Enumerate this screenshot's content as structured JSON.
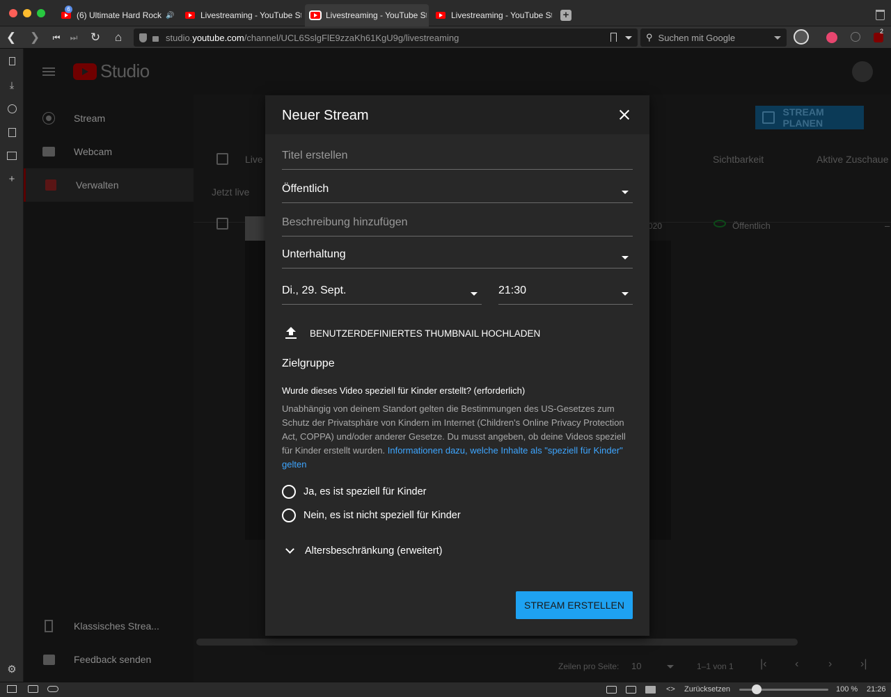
{
  "browser": {
    "tabs": [
      {
        "title": "(6) Ultimate Hard Rock",
        "badge": "6",
        "speaker": "🔊"
      },
      {
        "title": "Livestreaming - YouTube St"
      },
      {
        "title": "Livestreaming - YouTube St"
      },
      {
        "title": "Livestreaming - YouTube St"
      }
    ],
    "url_domain_prefix": "studio.",
    "url_domain": "youtube.com",
    "url_path": "/channel/UCL6SslgFlE9zzaKh61KgU9g/livestreaming",
    "search_placeholder": "Suchen mit Google",
    "ext_badge": "2",
    "status": {
      "reset": "Zurücksetzen",
      "zoom": "100 %",
      "time": "21:26"
    }
  },
  "studio": {
    "logo_text": "Studio",
    "nav": [
      {
        "label": "Stream"
      },
      {
        "label": "Webcam"
      },
      {
        "label": "Verwalten"
      }
    ],
    "nav_bottom": [
      {
        "label": "Klassisches Strea..."
      },
      {
        "label": "Feedback senden"
      }
    ],
    "schedule_button": "STREAM PLANEN",
    "table": {
      "col_live": "Live",
      "col_visibility": "Sichtbarkeit",
      "col_viewers": "Aktive Zuschaue",
      "section_live": "Jetzt live",
      "row_date": "020",
      "row_visibility": "Öffentlich",
      "row_viewers": "–"
    },
    "pagination": {
      "rows_label": "Zeilen pro Seite:",
      "rows_value": "10",
      "range": "1–1 von 1"
    }
  },
  "dialog": {
    "title": "Neuer Stream",
    "title_placeholder": "Titel erstellen",
    "visibility": "Öffentlich",
    "description_placeholder": "Beschreibung hinzufügen",
    "category": "Unterhaltung",
    "date": "Di., 29. Sept.",
    "time": "21:30",
    "thumbnail_button": "BENUTZERDEFINIERTES THUMBNAIL HOCHLADEN",
    "audience_heading": "Zielgruppe",
    "kids_question": "Wurde dieses Video speziell für Kinder erstellt? (erforderlich)",
    "kids_info": "Unabhängig von deinem Standort gelten die Bestimmungen des US-Gesetzes zum Schutz der Privatsphäre von Kindern im Internet (Children's Online Privacy Protection Act, COPPA) und/oder anderer Gesetze. Du musst angeben, ob deine Videos speziell für Kinder erstellt wurden. ",
    "kids_link": "Informationen dazu, welche Inhalte als \"speziell für Kinder\" gelten",
    "radio_yes": "Ja, es ist speziell für Kinder",
    "radio_no": "Nein, es ist nicht speziell für Kinder",
    "age_restriction": "Altersbeschränkung (erweitert)",
    "create_button": "STREAM ERSTELLEN"
  },
  "colors": {
    "accent": "#3ea6ff",
    "primary_button": "#1ea2f2",
    "yt_red": "#ff0000"
  }
}
